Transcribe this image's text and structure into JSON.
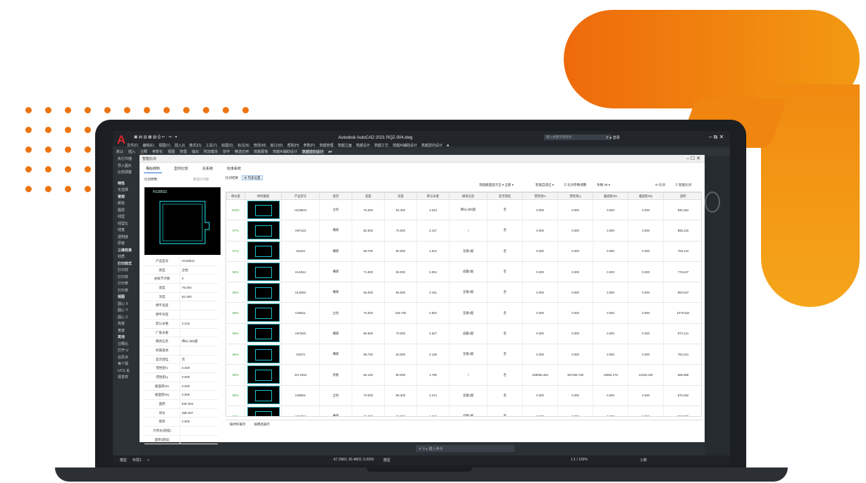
{
  "colors": {
    "accent_orange": "#ee6a0b",
    "accent_orange_light": "#f5a51a",
    "autocad_red": "#d8262d",
    "profile_cyan": "#1bc3cc",
    "similarity_green": "#3aa33a"
  },
  "app": {
    "title": "Autodesk AutoCAD 2021    RQZ-004.dwg",
    "search_placeholder": "键入关键字或短语",
    "user": "登录",
    "window_controls": "– ⧉ ✕",
    "quick_access": "▣ ▤ ▥ ▦ ▧ ⎙ ⇐ · ⇒ · ▾"
  },
  "menu": [
    "文件(F)",
    "编辑(E)",
    "视图(V)",
    "插入(I)",
    "格式(O)",
    "工具(T)",
    "绘图(D)",
    "标注(N)",
    "修改(M)",
    "窗口(W)",
    "帮助(H)",
    "参数(P)",
    "筑越管理",
    "筑越立面",
    "筑越设计",
    "筑越工艺",
    "筑越AI辅助设计",
    "筑越逆向设计",
    "■"
  ],
  "ribbon_tabs": [
    "默认",
    "插入",
    "注释",
    "参数化",
    "视图",
    "管理",
    "输出",
    "附加模块",
    "协作",
    "精选应用",
    "筑越幕墙",
    "筑越AI辅助设计",
    "筑越逆向设计",
    "■▾"
  ],
  "left_panel": {
    "top": [
      "执行扫描",
      "导入图片",
      "比例调整"
    ],
    "items": [
      {
        "label": "特性",
        "head": true
      },
      {
        "label": "无选择",
        "head": false
      },
      {
        "label": "常规",
        "head": true
      },
      {
        "label": "颜色",
        "head": false
      },
      {
        "label": "图层",
        "head": false
      },
      {
        "label": "线型",
        "head": false
      },
      {
        "label": "线型比",
        "head": false
      },
      {
        "label": "线宽",
        "head": false
      },
      {
        "label": "透明度",
        "head": false
      },
      {
        "label": "厚度",
        "head": false
      },
      {
        "label": "三维效果",
        "head": true
      },
      {
        "label": "材质",
        "head": false
      },
      {
        "label": "打印样式",
        "head": true
      },
      {
        "label": "打印样",
        "head": false
      },
      {
        "label": "打印样",
        "head": false
      },
      {
        "label": "打印表",
        "head": false
      },
      {
        "label": "打印表",
        "head": false
      },
      {
        "label": "视图",
        "head": true
      },
      {
        "label": "圆心 X",
        "head": false
      },
      {
        "label": "圆心 Y",
        "head": false
      },
      {
        "label": "圆心 Z",
        "head": false
      },
      {
        "label": "高度",
        "head": false
      },
      {
        "label": "宽度",
        "head": false
      },
      {
        "label": "其他",
        "head": true
      },
      {
        "label": "注释比",
        "head": false
      },
      {
        "label": "打开 U",
        "head": false
      },
      {
        "label": "在原点",
        "head": false
      },
      {
        "label": "每个视",
        "head": false
      },
      {
        "label": "UCS 名",
        "head": false
      },
      {
        "label": "视觉样",
        "head": false
      }
    ]
  },
  "dialog": {
    "title": "智能比对",
    "window_controls": "–  ☐  ✕",
    "tabs": [
      "相似材料",
      "型材比较",
      "关系链",
      "标准系统"
    ],
    "left": {
      "header": "比对原数",
      "reset_button": "重选比对图",
      "profile_code": "H128531",
      "properties": [
        {
          "k": "产品型号",
          "v": "H128531"
        },
        {
          "k": "类型",
          "v": "立柱"
        },
        {
          "k": "关联节点数",
          "v": "0"
        },
        {
          "k": "宽度",
          "v": "76.000"
        },
        {
          "k": "深度",
          "v": "92.400"
        },
        {
          "k": "撑平宽度",
          "v": ""
        },
        {
          "k": "撑平深度",
          "v": ""
        },
        {
          "k": "默认米重",
          "v": "3.243"
        },
        {
          "k": "厂家米重",
          "v": ""
        },
        {
          "k": "模具信息",
          "v": "佛山 (88)套"
        },
        {
          "k": "所属基地",
          "v": ""
        },
        {
          "k": "是否借挂",
          "v": "否"
        },
        {
          "k": "惯性矩Ix",
          "v": "0.000"
        },
        {
          "k": "惯性矩Iy",
          "v": "0.000"
        },
        {
          "k": "截面矩Wx",
          "v": "0.000"
        },
        {
          "k": "截面矩Wy",
          "v": "0.000"
        },
        {
          "k": "面积",
          "v": "830.364"
        },
        {
          "k": "周长",
          "v": "389.307"
        },
        {
          "k": "壁厚",
          "v": "2.500"
        },
        {
          "k": "外周长(圆弧)",
          "v": ""
        },
        {
          "k": "面积(圆弧)",
          "v": ""
        }
      ]
    },
    "right": {
      "header": "比对结果",
      "column_settings": "列表设置",
      "filters": {
        "label1": "筑越截面显示全",
        "sel1": "全部",
        "label2": "智能自适应",
        "btn_params": "比对参数调整",
        "count_label": "条数",
        "count_value": "30"
      },
      "btn_compare": "比对",
      "btn_compare_all": "智能比对",
      "columns": [
        "相似度",
        "材料截面",
        "产品型号",
        "类型",
        "宽度",
        "深度",
        "默认米重",
        "模具信息",
        "是否借挂",
        "惯性矩Ix",
        "惯性矩Iy",
        "截面矩Wx",
        "截面矩Wy",
        "面积"
      ],
      "rows": [
        [
          "100%",
          "",
          "H128531",
          "立柱",
          "76.000",
          "92.400",
          "3.243",
          "佛山 (88)套",
          "否",
          "0.000",
          "0.000",
          "0.000",
          "0.000",
          "830.364"
        ],
        [
          "97%",
          "",
          "H87123",
          "横梁",
          "82.500",
          "70.000",
          "2.417",
          "/",
          "否",
          "0.000",
          "0.000",
          "0.000",
          "0.000",
          "895.232"
        ],
        [
          "97%",
          "",
          "H5343",
          "横梁",
          "69.700",
          "80.000",
          "1.912",
          "宜春4套",
          "否",
          "0.000",
          "0.000",
          "0.000",
          "0.000",
          "708.134"
        ],
        [
          "96%",
          "",
          "HL5044",
          "横梁",
          "71.500",
          "65.000",
          "2.094",
          "成都4套",
          "否",
          "0.000",
          "0.000",
          "0.000",
          "0.000",
          "775.547"
        ],
        [
          "96%",
          "",
          "HL5053",
          "横梁",
          "65.000",
          "96.500",
          "2.431",
          "宜春4套",
          "否",
          "0.000",
          "0.000",
          "0.000",
          "0.000",
          "900.547"
        ],
        [
          "96%",
          "",
          "H36611",
          "立柱",
          "76.000",
          "106.700",
          "2.904",
          "宜春4套",
          "否",
          "0.000",
          "0.000",
          "0.000",
          "0.000",
          "1075.532"
        ],
        [
          "96%",
          "",
          "H67840",
          "横梁",
          "96.500",
          "70.000",
          "2.627",
          "成都4套",
          "否",
          "0.000",
          "0.000",
          "0.000",
          "0.000",
          "973.121"
        ],
        [
          "96%",
          "",
          "H5373",
          "横梁",
          "89.700",
          "60.000",
          "2.139",
          "宜春4套",
          "否",
          "0.000",
          "0.000",
          "0.000",
          "0.000",
          "792.221"
        ],
        [
          "96%",
          "",
          "GX-1932",
          "挤框",
          "65.100",
          "80.000",
          "1.790",
          "/",
          "否",
          "328865.364",
          "367459.738",
          "10962.179",
          "11020.230",
          "665.988"
        ],
        [
          "96%",
          "",
          "H36561",
          "立柱",
          "70.000",
          "98.300",
          "2.374",
          "宜春4套",
          "否",
          "0.000",
          "0.000",
          "0.000",
          "0.000",
          "879.282"
        ],
        [
          "96%",
          "",
          "H86753",
          "横梁",
          "65.700",
          "60.000",
          "1.522",
          "成都4套",
          "否",
          "0.000",
          "0.000",
          "0.000",
          "0.000",
          "563.772"
        ]
      ],
      "bottom_tabs": [
        "按材料展示",
        "按模具展示"
      ]
    }
  },
  "command_line": {
    "placeholder": "键入命令"
  },
  "status": {
    "tabs": [
      "模型",
      "布局1",
      "+"
    ],
    "coords": "-67.3983, 36.4803, 0.0000",
    "mode": "模型",
    "scale": "1:1 / 100%",
    "units": "小数"
  }
}
